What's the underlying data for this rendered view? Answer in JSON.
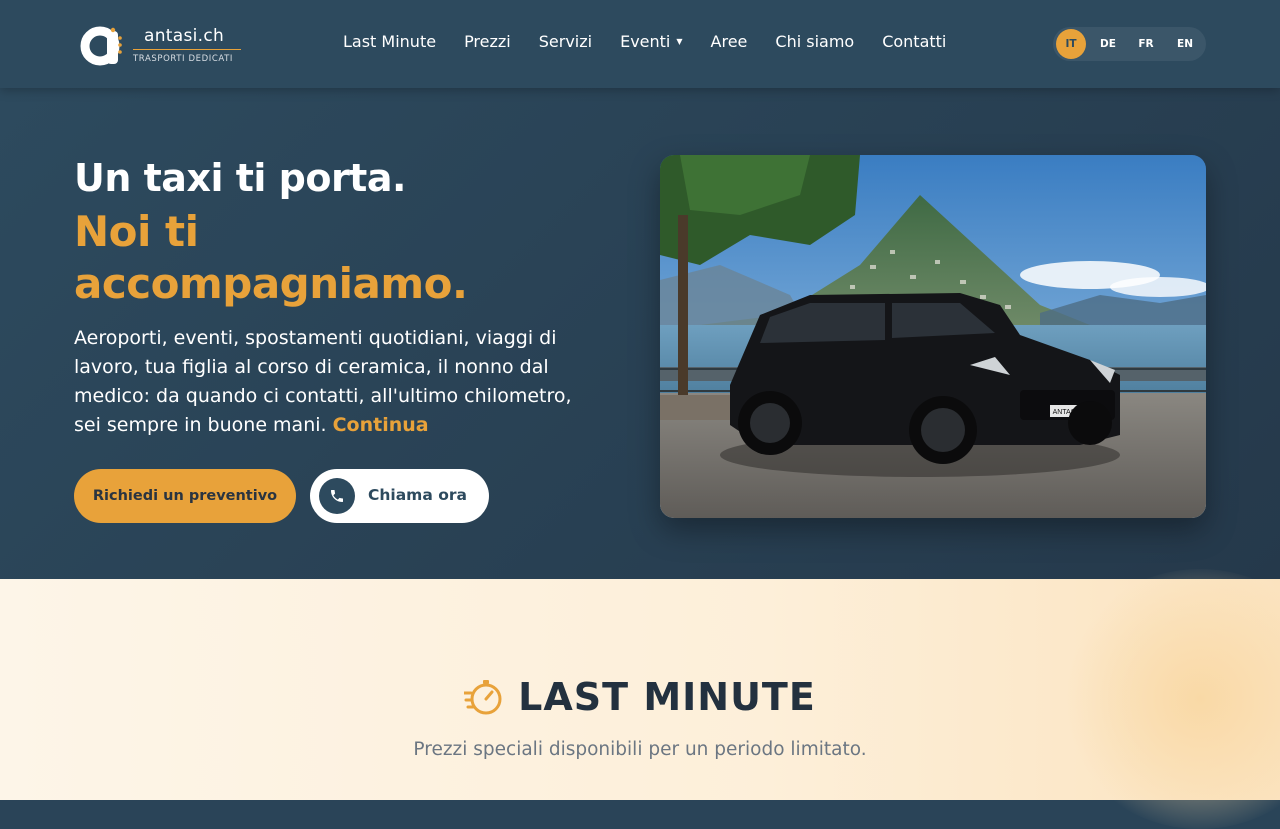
{
  "brand": {
    "name": "antasi.ch",
    "tagline": "TRASPORTI DEDICATI"
  },
  "nav": {
    "items": [
      {
        "label": "Last Minute"
      },
      {
        "label": "Prezzi"
      },
      {
        "label": "Servizi"
      },
      {
        "label": "Eventi",
        "has_dropdown": true
      },
      {
        "label": "Aree"
      },
      {
        "label": "Chi siamo"
      },
      {
        "label": "Contatti"
      }
    ]
  },
  "languages": {
    "options": [
      "IT",
      "DE",
      "FR",
      "EN"
    ],
    "active": "IT"
  },
  "hero": {
    "title_line1": "Un taxi ti porta.",
    "title_line2": "Noi ti accompagniamo.",
    "lead": "Aeroporti, eventi, spostamenti quotidiani, viaggi di lavoro, tua figlia al corso di ceramica, il nonno dal medico: da quando ci contatti, all'ultimo chilometro, sei sempre in buone mani.",
    "lead_link": "Continua",
    "cta_primary": "Richiedi un preventivo",
    "cta_call": "Chiama ora",
    "car_plate": "ANTASI.CH"
  },
  "last_minute": {
    "title": "LAST MINUTE",
    "subtitle": "Prezzi speciali disponibili per un periodo limitato."
  },
  "colors": {
    "accent": "#e8a23a",
    "navy": "#2d4a5e",
    "text_dark": "#23313f"
  },
  "icons": {
    "call": "phone-icon",
    "section": "stopwatch-icon",
    "dropdown": "caret-down-icon"
  }
}
